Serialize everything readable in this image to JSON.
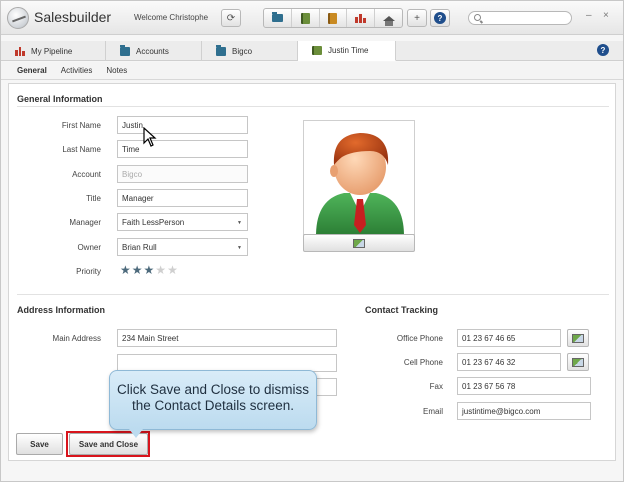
{
  "app": {
    "title": "Salesbuilder",
    "welcome": "Welcome Christophe"
  },
  "toolbar": {
    "refresh_icon": "refresh-icon",
    "nav_icons": [
      "accounts-folder-icon",
      "contacts-book-icon",
      "orange-book-icon",
      "pipeline-chart-icon",
      "home-icon"
    ],
    "add_label": "+",
    "help_label": "?",
    "window_controls": [
      "–",
      "×"
    ]
  },
  "tabs": [
    {
      "label": "My Pipeline",
      "icon": "pipeline-chart-icon"
    },
    {
      "label": "Accounts",
      "icon": "folder-icon"
    },
    {
      "label": "Bigco",
      "icon": "folder-icon"
    },
    {
      "label": "Justin Time",
      "icon": "contact-book-icon",
      "active": true
    }
  ],
  "subtabs": [
    {
      "label": "General",
      "active": true
    },
    {
      "label": "Activities"
    },
    {
      "label": "Notes"
    }
  ],
  "general": {
    "section_title": "General Information",
    "labels": {
      "first_name": "First Name",
      "last_name": "Last Name",
      "account": "Account",
      "title": "Title",
      "manager": "Manager",
      "owner": "Owner",
      "priority": "Priority"
    },
    "values": {
      "first_name": "Justin",
      "last_name": "Time",
      "account": "Bigco",
      "title": "Manager",
      "manager": "Faith LessPerson",
      "owner": "Brian Rull"
    },
    "priority_rating": 3,
    "priority_max": 5
  },
  "address": {
    "section_title": "Address Information",
    "main_label": "Main Address",
    "lines": [
      "234 Main Street",
      "",
      ""
    ]
  },
  "contact": {
    "section_title": "Contact Tracking",
    "labels": {
      "office_phone": "Office Phone",
      "cell_phone": "Cell Phone",
      "fax": "Fax",
      "email": "Email"
    },
    "values": {
      "office_phone": "01 23 67 46 65",
      "cell_phone": "01 23 67 46 32",
      "fax": "01 23 67 56 78",
      "email": "justintime@bigco.com"
    }
  },
  "buttons": {
    "save": "Save",
    "save_close": "Save and Close"
  },
  "callout": {
    "line1": "Click Save and Close to dismiss",
    "line2": "the Contact Details screen."
  },
  "colors": {
    "highlight": "#d8141c",
    "callout_bg": "#bcdbef",
    "star_on": "#4d6a7c"
  }
}
